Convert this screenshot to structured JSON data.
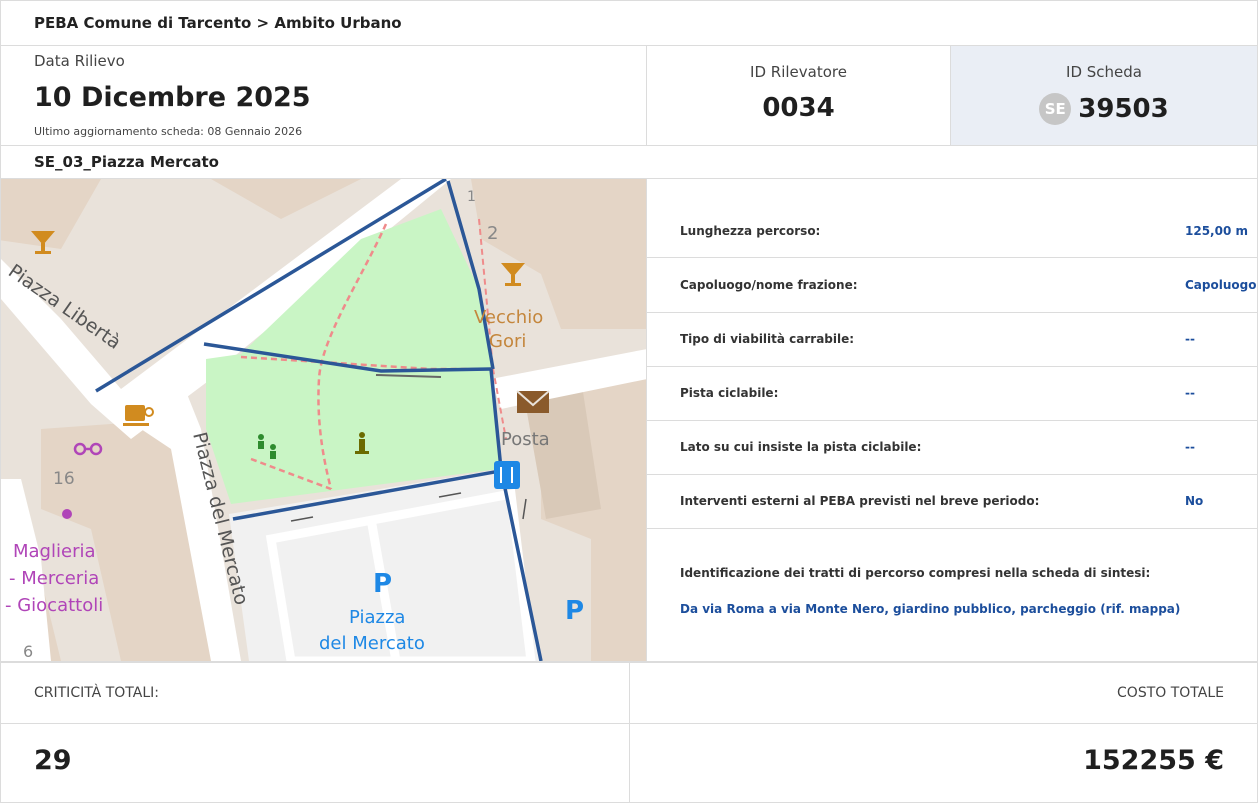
{
  "header": {
    "breadcrumb": "PEBA Comune di Tarcento > Ambito Urbano"
  },
  "info": {
    "data_label": "Data Rilievo",
    "data_value": "10 Dicembre 2025",
    "update_note": "Ultimo aggiornamento scheda: 08 Gennaio 2026",
    "rilevatore_label": "ID Rilevatore",
    "rilevatore_value": "0034",
    "scheda_label": "ID Scheda",
    "scheda_badge": "SE",
    "scheda_value": "39503"
  },
  "scheda_name": "SE_03_Piazza Mercato",
  "map": {
    "labels": {
      "via": "Piazza Libertà",
      "piazza": "Piazza del Mercato",
      "vecchio": "Vecchio",
      "gori": "Gori",
      "posta": "Posta",
      "maglieria": "Maglieria",
      "merceria": "- Merceria",
      "giocattoli": "- Giocattoli",
      "parking_name_1": "Piazza",
      "parking_name_2": "del Mercato",
      "parking_symbol": "P",
      "n1": "1",
      "n2": "2",
      "n16": "16",
      "n6": "6"
    }
  },
  "details": {
    "lunghezza_label": "Lunghezza percorso:",
    "lunghezza_value": "125,00 m",
    "frazione_label": "Capoluogo/nome frazione:",
    "frazione_value": "Capoluogo",
    "viabilita_label": "Tipo di viabilità carrabile:",
    "viabilita_value": "--",
    "pista_label": "Pista ciclabile:",
    "pista_value": "--",
    "lato_label": "Lato su cui insiste la pista ciclabile:",
    "lato_value": "--",
    "interventi_label": "Interventi esterni al PEBA previsti nel breve periodo:",
    "interventi_value": "No",
    "tratti_label": "Identificazione dei tratti di percorso compresi nella scheda di sintesi:",
    "tratti_value": "Da via Roma a via Monte Nero, giardino pubblico, parcheggio (rif. mappa)"
  },
  "totals": {
    "criticita_label": "CRITICITÀ TOTALI:",
    "criticita_value": "29",
    "costo_label": "COSTO TOTALE",
    "costo_value": "152255 €"
  },
  "colors": {
    "accent_blue": "#1c4e9c",
    "route_line": "#2b5797",
    "park_green": "#c9f5c5",
    "scheda_bg": "#eaeef5"
  }
}
